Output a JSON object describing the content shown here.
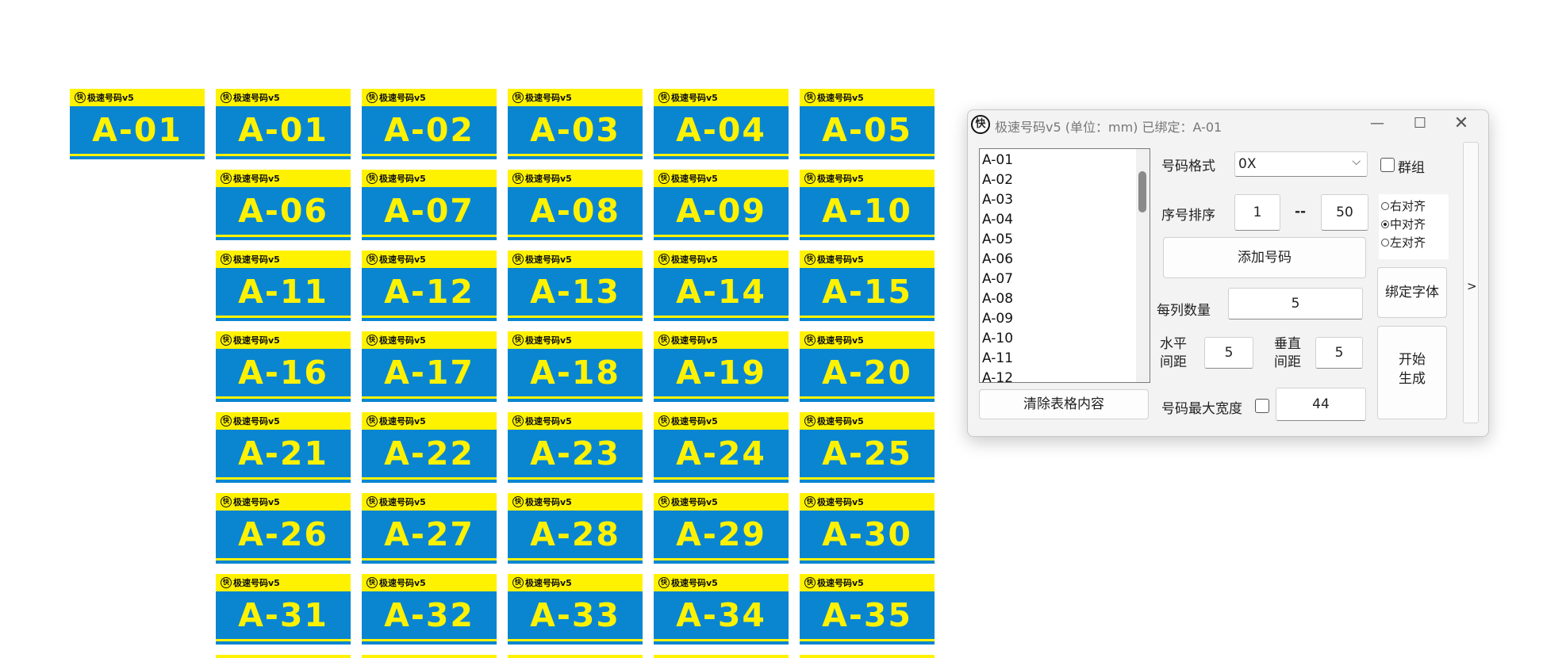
{
  "tiles": {
    "brand": "极速号码v5",
    "logo_char": "快",
    "colors": {
      "yellow": "#fff200",
      "blue": "#0a86d1",
      "text": "#111111"
    },
    "preview_number": "A-01",
    "grid_numbers": [
      [
        "A-01",
        "A-02",
        "A-03",
        "A-04",
        "A-05"
      ],
      [
        "A-06",
        "A-07",
        "A-08",
        "A-09",
        "A-10"
      ],
      [
        "A-11",
        "A-12",
        "A-13",
        "A-14",
        "A-15"
      ],
      [
        "A-16",
        "A-17",
        "A-18",
        "A-19",
        "A-20"
      ],
      [
        "A-21",
        "A-22",
        "A-23",
        "A-24",
        "A-25"
      ],
      [
        "A-26",
        "A-27",
        "A-28",
        "A-29",
        "A-30"
      ],
      [
        "A-31",
        "A-32",
        "A-33",
        "A-34",
        "A-35"
      ]
    ]
  },
  "dialog": {
    "app_icon_char": "快",
    "title": "极速号码v5 (单位：mm)  已绑定：A-01",
    "window_controls": {
      "minimize": "—",
      "maximize": "☐",
      "close": "✕"
    },
    "list_items": [
      "A-01",
      "A-02",
      "A-03",
      "A-04",
      "A-05",
      "A-06",
      "A-07",
      "A-08",
      "A-09",
      "A-10",
      "A-11",
      "A-12"
    ],
    "format_label": "号码格式",
    "format_value": "0X",
    "group_label": "群组",
    "seq_label": "序号排序",
    "seq_from": "1",
    "seq_sep": "--",
    "seq_to": "50",
    "add_button": "添加号码",
    "align_options": [
      {
        "label": "右对齐",
        "selected": false
      },
      {
        "label": "中对齐",
        "selected": true
      },
      {
        "label": "左对齐",
        "selected": false
      }
    ],
    "per_column_label": "每列数量",
    "per_column_value": "5",
    "bind_font_button": "绑定字体",
    "h_gap_label": "水平间距",
    "h_gap_value": "5",
    "v_gap_label": "垂直间距",
    "v_gap_value": "5",
    "start_button": "开始生成",
    "clear_button": "清除表格内容",
    "max_width_label": "号码最大宽度",
    "max_width_value": "44",
    "expand_button": ">"
  }
}
